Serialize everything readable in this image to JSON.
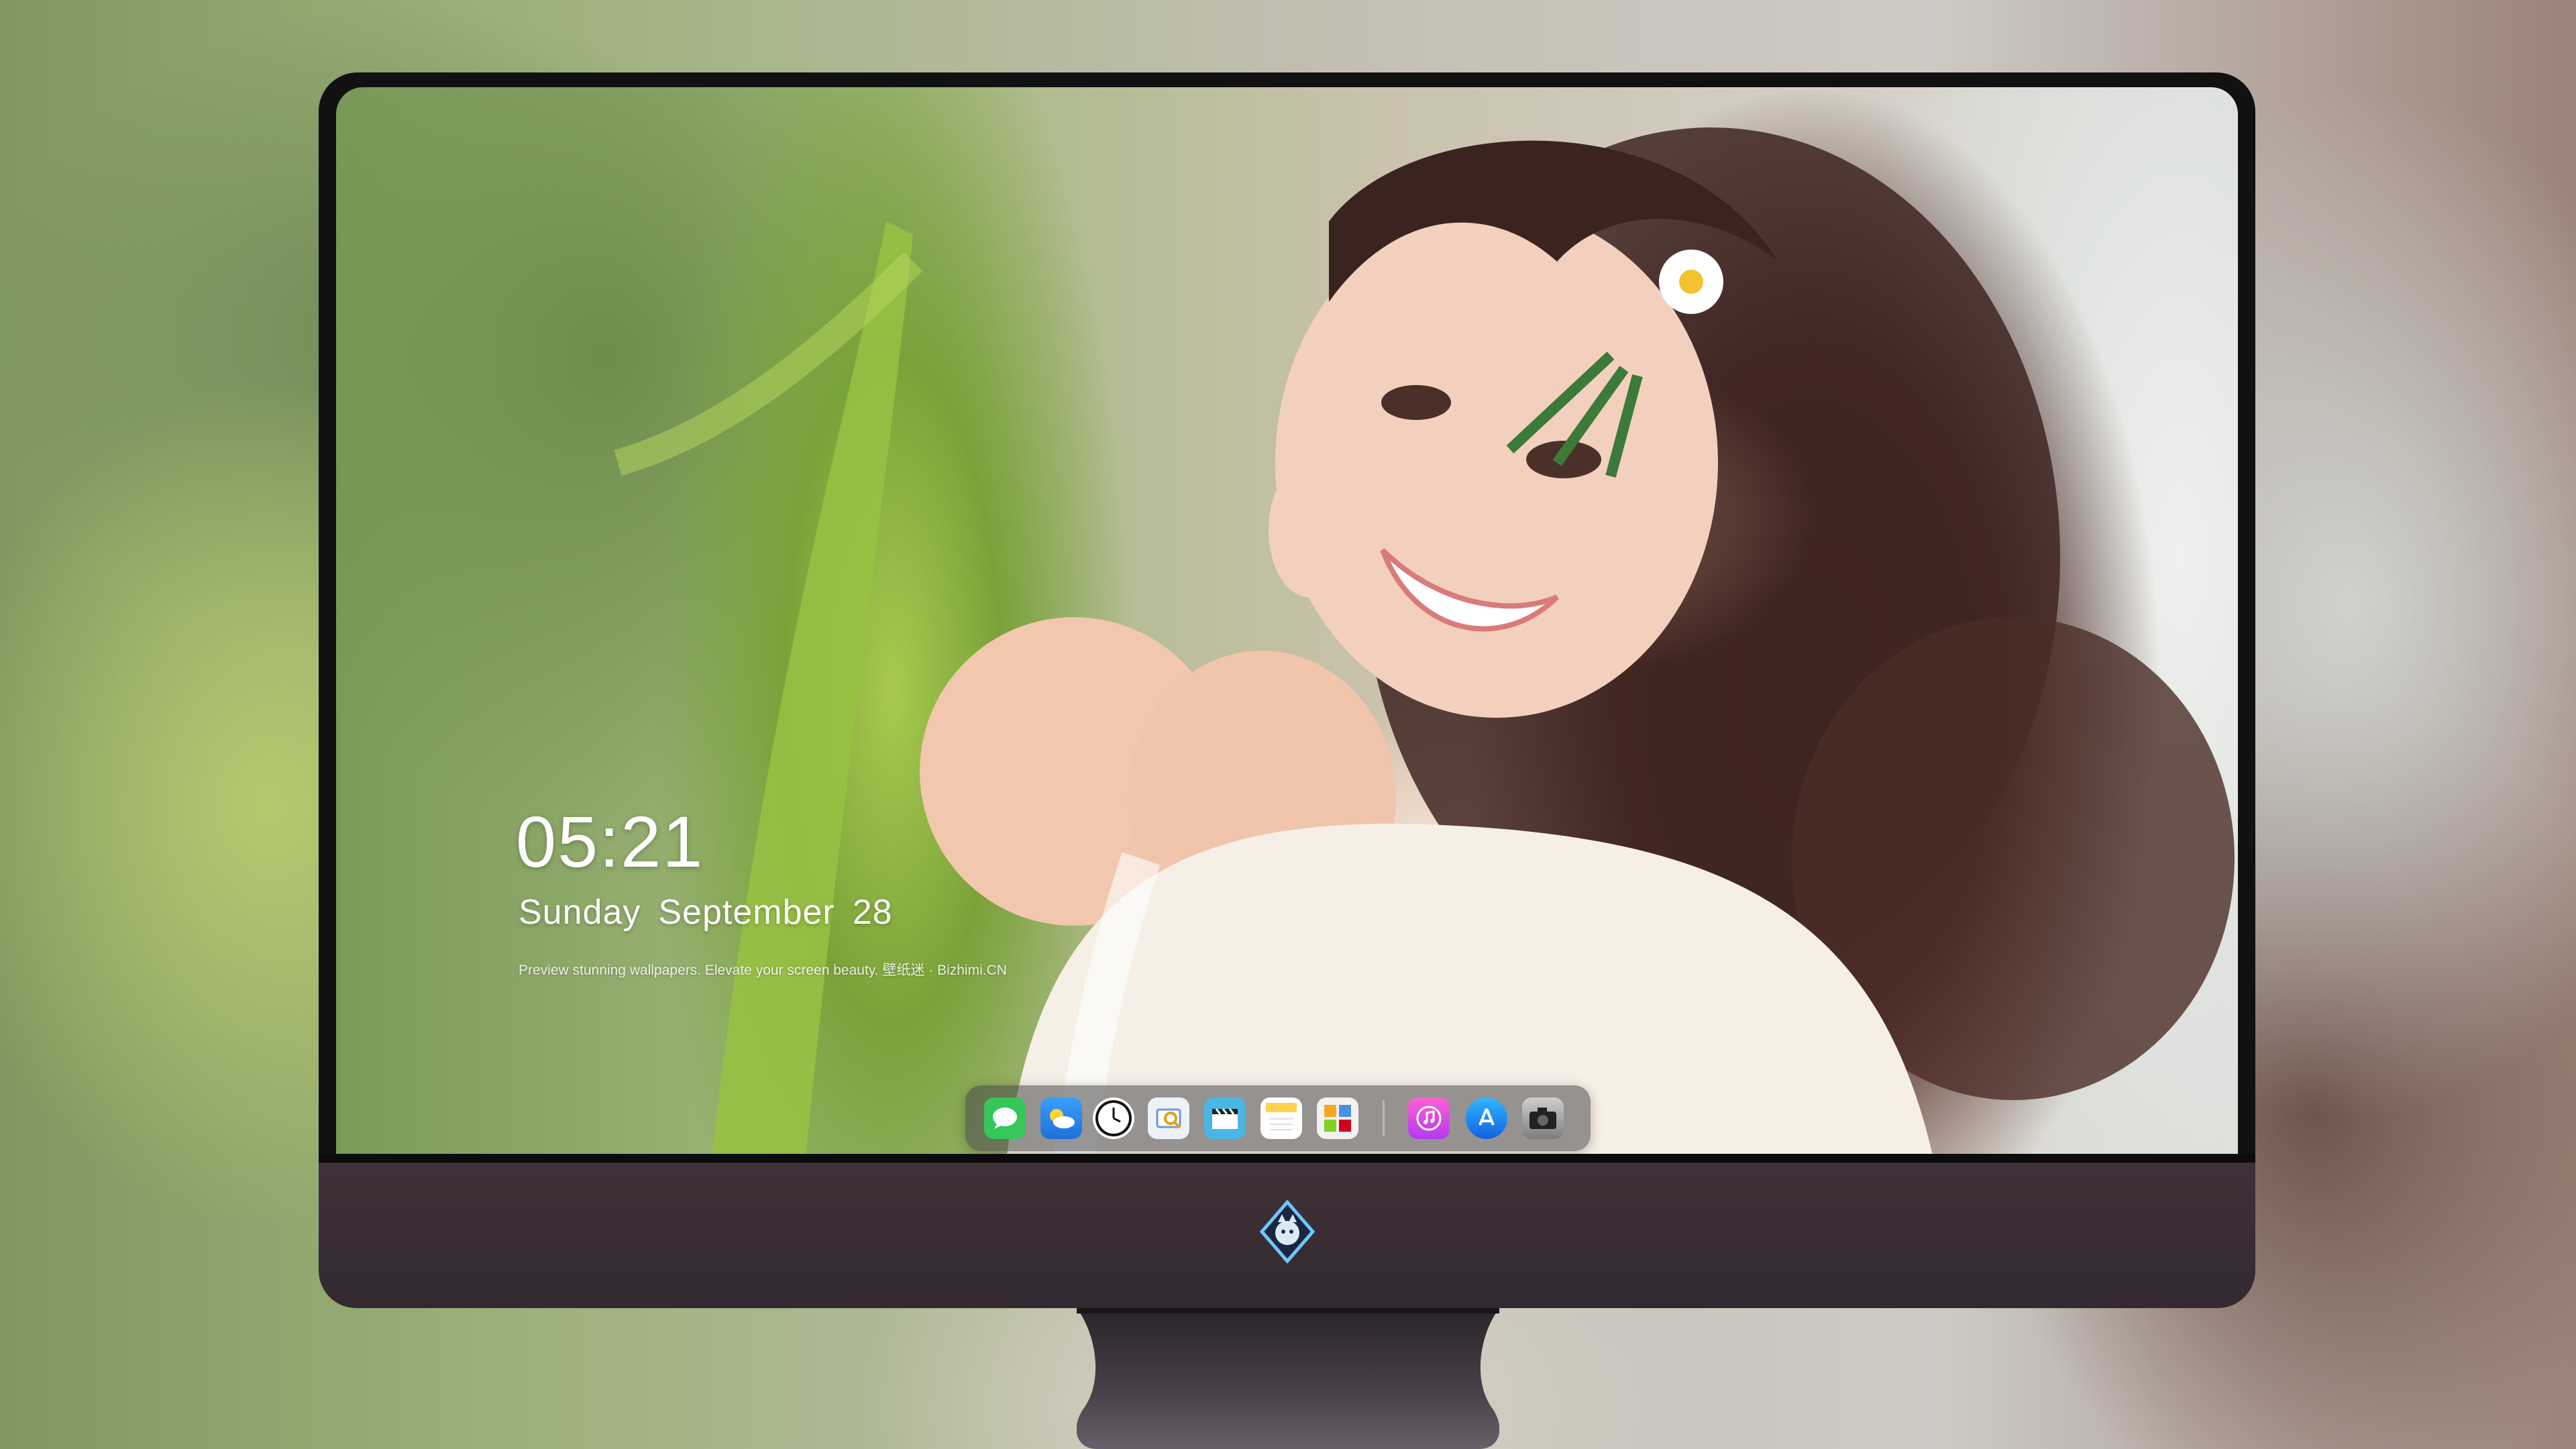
{
  "lockscreen": {
    "time": "05:21",
    "date": {
      "weekday": "Sunday",
      "month": "September",
      "day": "28"
    },
    "tagline": "Preview stunning wallpapers. Elevate your screen beauty. 壁纸迷 · Bizhimi.CN"
  },
  "dock": {
    "apps": [
      {
        "name": "messages-icon",
        "color": "#35c759"
      },
      {
        "name": "weather-icon",
        "color": "#2f8cf0"
      },
      {
        "name": "clock-icon",
        "color": "#111111"
      },
      {
        "name": "preview-icon",
        "color": "#f1f1f1"
      },
      {
        "name": "clips-icon",
        "color": "#4ab6e6"
      },
      {
        "name": "notes-icon",
        "color": "#ffd34d"
      },
      {
        "name": "photo-gallery-icon",
        "color": "#f2f2f2"
      },
      {
        "name": "music-icon",
        "color": "#e94cc8"
      },
      {
        "name": "app-store-icon",
        "color": "#1c8cf5"
      },
      {
        "name": "camera-icon",
        "color": "#9a9a9a"
      }
    ]
  },
  "colors": {
    "bezel": "#111111",
    "chin": "#3b2f36",
    "stand": "#2e2a2f"
  }
}
